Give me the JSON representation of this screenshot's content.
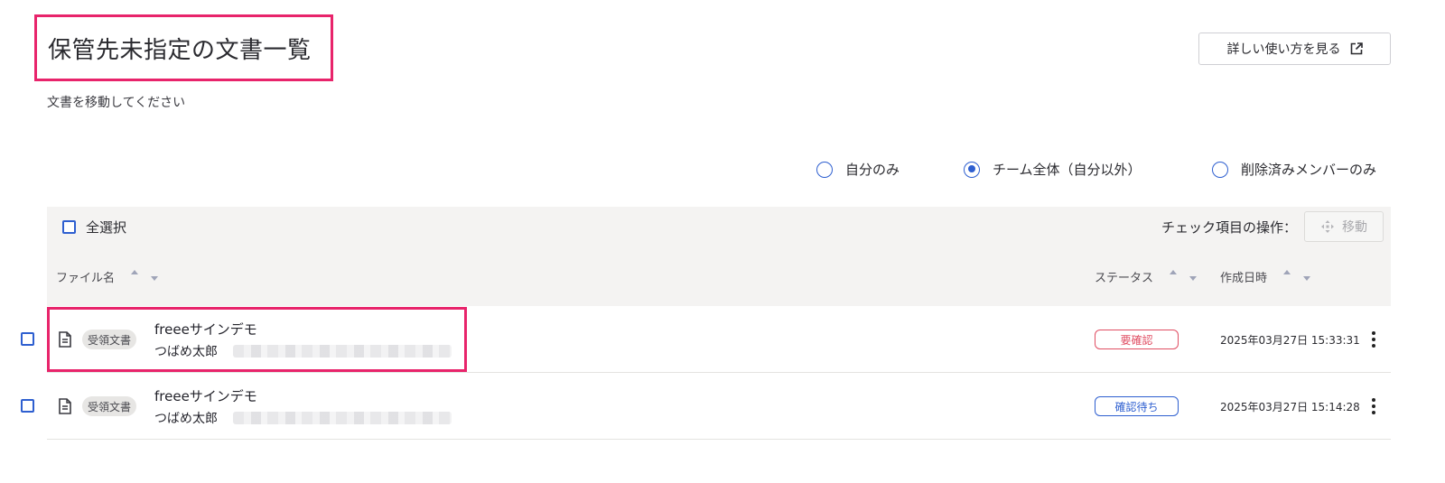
{
  "header": {
    "title": "保管先未指定の文書一覧",
    "subtitle": "文書を移動してください",
    "help_button": "詳しい使い方を見る"
  },
  "filter": {
    "options": [
      {
        "label": "自分のみ",
        "selected": false
      },
      {
        "label": "チーム全体（自分以外）",
        "selected": true
      },
      {
        "label": "削除済みメンバーのみ",
        "selected": false
      }
    ]
  },
  "toolbar": {
    "select_all": "全選択",
    "bulk_label": "チェック項目の操作：",
    "move_button": "移動"
  },
  "columns": {
    "file_name": "ファイル名",
    "status": "ステータス",
    "created_at": "作成日時"
  },
  "rows": [
    {
      "doc_type": "受領文書",
      "file_name": "freeeサインデモ",
      "owner": "つばめ太郎",
      "status": "要確認",
      "status_color": "#e04e63",
      "created_at": "2025年03月27日 15:33:31"
    },
    {
      "doc_type": "受領文書",
      "file_name": "freeeサインデモ",
      "owner": "つばめ太郎",
      "status": "確認待ち",
      "status_color": "#2e5fd0",
      "created_at": "2025年03月27日 15:14:28"
    }
  ],
  "colors": {
    "accent": "#2e5fd0",
    "highlight": "#e8246b"
  }
}
